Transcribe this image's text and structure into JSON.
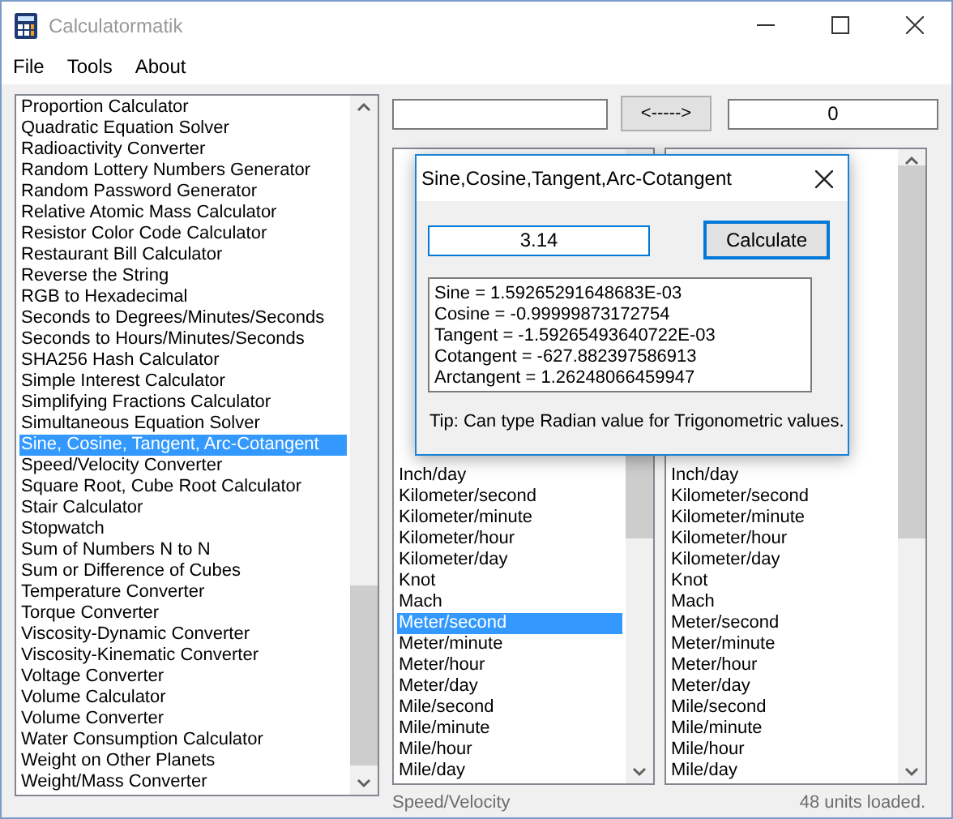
{
  "window": {
    "title": "Calculatormatik"
  },
  "menu": [
    "File",
    "Tools",
    "About"
  ],
  "calculators": [
    {
      "label": "Proportion Calculator",
      "selected": false
    },
    {
      "label": "Quadratic Equation Solver",
      "selected": false
    },
    {
      "label": "Radioactivity Converter",
      "selected": false
    },
    {
      "label": "Random Lottery Numbers Generator",
      "selected": false
    },
    {
      "label": "Random Password Generator",
      "selected": false
    },
    {
      "label": "Relative Atomic Mass Calculator",
      "selected": false
    },
    {
      "label": "Resistor Color Code Calculator",
      "selected": false
    },
    {
      "label": "Restaurant Bill Calculator",
      "selected": false
    },
    {
      "label": "Reverse the String",
      "selected": false
    },
    {
      "label": "RGB to Hexadecimal",
      "selected": false
    },
    {
      "label": "Seconds to Degrees/Minutes/Seconds",
      "selected": false
    },
    {
      "label": "Seconds to Hours/Minutes/Seconds",
      "selected": false
    },
    {
      "label": "SHA256 Hash Calculator",
      "selected": false
    },
    {
      "label": "Simple Interest Calculator",
      "selected": false
    },
    {
      "label": "Simplifying Fractions Calculator",
      "selected": false
    },
    {
      "label": "Simultaneous Equation Solver",
      "selected": false
    },
    {
      "label": "Sine, Cosine, Tangent, Arc-Cotangent",
      "selected": true
    },
    {
      "label": "Speed/Velocity Converter",
      "selected": false
    },
    {
      "label": "Square Root, Cube Root Calculator",
      "selected": false
    },
    {
      "label": "Stair Calculator",
      "selected": false
    },
    {
      "label": "Stopwatch",
      "selected": false
    },
    {
      "label": "Sum of Numbers N to N",
      "selected": false
    },
    {
      "label": "Sum or Difference of Cubes",
      "selected": false
    },
    {
      "label": "Temperature Converter",
      "selected": false
    },
    {
      "label": "Torque Converter",
      "selected": false
    },
    {
      "label": "Viscosity-Dynamic Converter",
      "selected": false
    },
    {
      "label": "Viscosity-Kinematic Converter",
      "selected": false
    },
    {
      "label": "Voltage Converter",
      "selected": false
    },
    {
      "label": "Volume Calculator",
      "selected": false
    },
    {
      "label": "Volume Converter",
      "selected": false
    },
    {
      "label": "Water Consumption Calculator",
      "selected": false
    },
    {
      "label": "Weight on Other Planets",
      "selected": false
    },
    {
      "label": "Weight/Mass Converter",
      "selected": false
    }
  ],
  "converter": {
    "swap_button": "<----->",
    "output_value": "0",
    "from_units": [
      {
        "label": "Inch/day",
        "selected": false
      },
      {
        "label": "Kilometer/second",
        "selected": false
      },
      {
        "label": "Kilometer/minute",
        "selected": false
      },
      {
        "label": "Kilometer/hour",
        "selected": false
      },
      {
        "label": "Kilometer/day",
        "selected": false
      },
      {
        "label": "Knot",
        "selected": false
      },
      {
        "label": "Mach",
        "selected": false
      },
      {
        "label": "Meter/second",
        "selected": true
      },
      {
        "label": "Meter/minute",
        "selected": false
      },
      {
        "label": "Meter/hour",
        "selected": false
      },
      {
        "label": "Meter/day",
        "selected": false
      },
      {
        "label": "Mile/second",
        "selected": false
      },
      {
        "label": "Mile/minute",
        "selected": false
      },
      {
        "label": "Mile/hour",
        "selected": false
      },
      {
        "label": "Mile/day",
        "selected": false
      }
    ],
    "to_units": [
      {
        "label": "Inch/day",
        "selected": false
      },
      {
        "label": "Kilometer/second",
        "selected": false
      },
      {
        "label": "Kilometer/minute",
        "selected": false
      },
      {
        "label": "Kilometer/hour",
        "selected": false
      },
      {
        "label": "Kilometer/day",
        "selected": false
      },
      {
        "label": "Knot",
        "selected": false
      },
      {
        "label": "Mach",
        "selected": false
      },
      {
        "label": "Meter/second",
        "selected": false
      },
      {
        "label": "Meter/minute",
        "selected": false
      },
      {
        "label": "Meter/hour",
        "selected": false
      },
      {
        "label": "Meter/day",
        "selected": false
      },
      {
        "label": "Mile/second",
        "selected": false
      },
      {
        "label": "Mile/minute",
        "selected": false
      },
      {
        "label": "Mile/hour",
        "selected": false
      },
      {
        "label": "Mile/day",
        "selected": false
      }
    ]
  },
  "status_bar": {
    "category": "Speed/Velocity",
    "count": "48 units loaded."
  },
  "dialog": {
    "title": "Sine,Cosine,Tangent,Arc-Cotangent",
    "input_value": "3.14",
    "button": "Calculate",
    "results": [
      "Sine = 1.59265291648683E-03",
      "Cosine = -0.99999873172754",
      "Tangent = -1.59265493640722E-03",
      "Cotangent = -627.882397586913",
      "Arctangent = 1.26248066459947"
    ],
    "tip": "Tip: Can type Radian value for Trigonometric values."
  }
}
